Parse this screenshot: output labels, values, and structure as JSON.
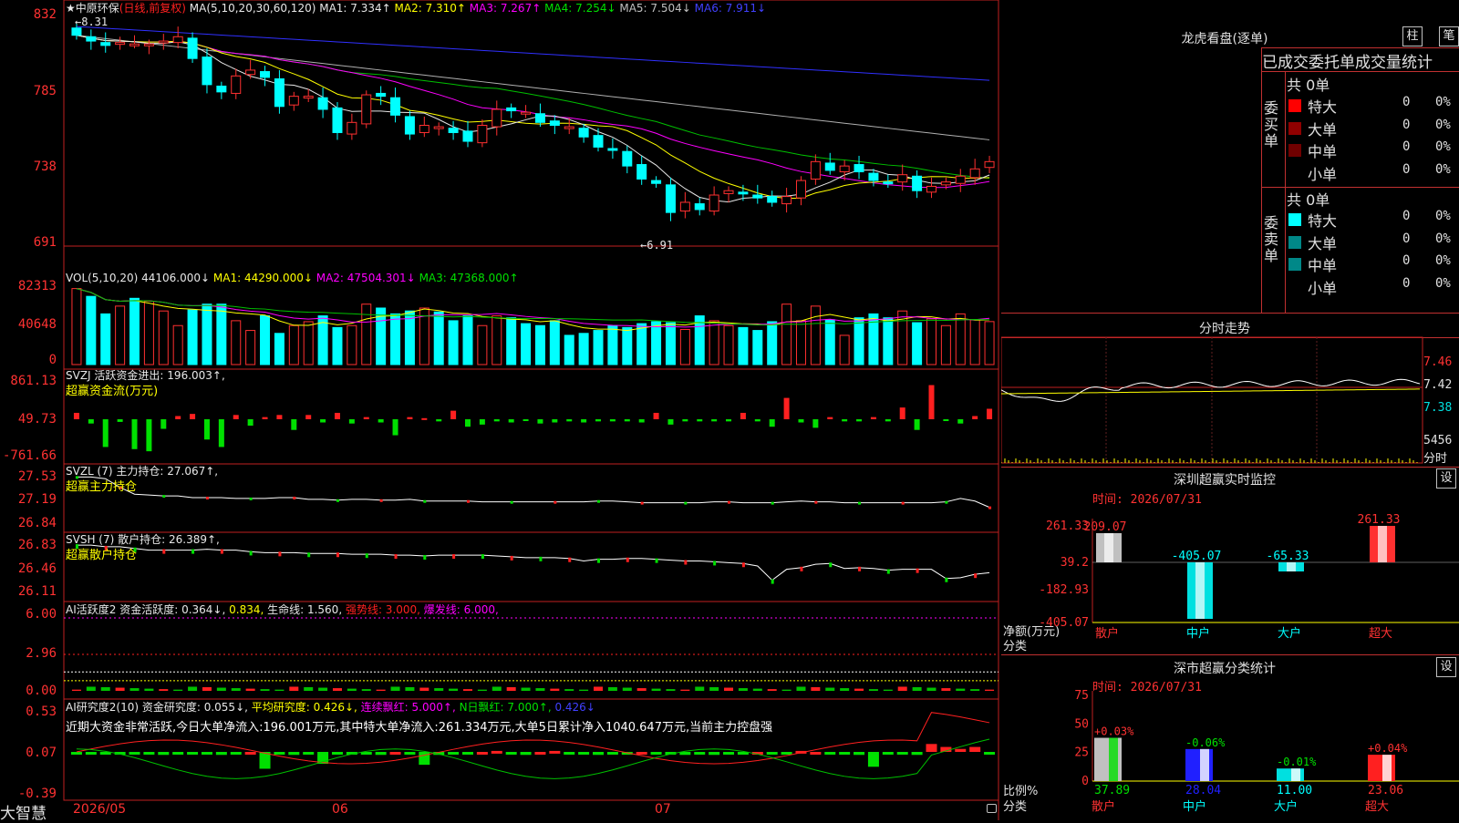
{
  "stock": {
    "name_line": "★中原环保",
    "period": "(日线,前复权)"
  },
  "ma_header": {
    "title": "MA(5,10,20,30,60,120)",
    "items": [
      {
        "label": "MA1:",
        "value": "7.334",
        "dir": "↑",
        "color": "#e8e8e8"
      },
      {
        "label": "MA2:",
        "value": "7.310",
        "dir": "↑",
        "color": "#ffff00"
      },
      {
        "label": "MA3:",
        "value": "7.267",
        "dir": "↑",
        "color": "#ff00ff"
      },
      {
        "label": "MA4:",
        "value": "7.254",
        "dir": "↓",
        "color": "#00e000"
      },
      {
        "label": "MA5:",
        "value": "7.504",
        "dir": "↓",
        "color": "#c0c0c0"
      },
      {
        "label": "MA6:",
        "value": "7.911",
        "dir": "↓",
        "color": "#4040ff"
      }
    ]
  },
  "annotations": {
    "high": "8.31",
    "low": "6.91"
  },
  "price_axis": [
    "832",
    "785",
    "738",
    "691"
  ],
  "vol_header": {
    "title": "VOL(5,10,20)",
    "value": "44106.000↓",
    "items": [
      {
        "label": "MA1:",
        "value": "44290.000↓",
        "color": "#ffff00"
      },
      {
        "label": "MA2:",
        "value": "47504.301↓",
        "color": "#ff00ff"
      },
      {
        "label": "MA3:",
        "value": "47368.000↑",
        "color": "#00e000"
      }
    ]
  },
  "vol_axis": [
    "82313",
    "40648",
    "0"
  ],
  "svzj": {
    "title": "SVZJ",
    "label": "活跃资金进出:",
    "value": "196.003↑,",
    "sub": "超赢资金流(万元)",
    "axis": [
      "861.13",
      "49.73",
      "-761.66"
    ]
  },
  "svzl": {
    "title": "SVZL (7)",
    "label": "主力持仓:",
    "value": "27.067↑,",
    "sub": "超赢主力持仓",
    "axis": [
      "27.53",
      "27.19",
      "26.84"
    ]
  },
  "svsh": {
    "title": "SVSH (7)",
    "label": "散户持仓:",
    "value": "26.389↑,",
    "sub": "超赢散户持仓",
    "axis": [
      "26.83",
      "26.46",
      "26.11"
    ]
  },
  "ai_active": {
    "title": "AI活跃度2",
    "items": [
      {
        "text": "资金活跃度: 0.364↓,",
        "color": "#e8e8e8"
      },
      {
        "text": "0.834,",
        "color": "#ffff00"
      },
      {
        "text": "生命线: 1.560,",
        "color": "#e8e8e8"
      },
      {
        "text": "强势线: 3.000,",
        "color": "#ff2020"
      },
      {
        "text": "爆发线: 6.000,",
        "color": "#ff00ff"
      }
    ],
    "axis": [
      "6.00",
      "2.96",
      "0.00"
    ]
  },
  "ai_research": {
    "title": "AI研究度2(10)",
    "items": [
      {
        "text": "资金研究度: 0.055↓,",
        "color": "#e8e8e8"
      },
      {
        "text": "平均研究度: 0.426↓,",
        "color": "#ffff00"
      },
      {
        "text": "连续飘红: 5.000↑,",
        "color": "#ff00ff"
      },
      {
        "text": "N日飘红: 7.000↑,",
        "color": "#00e000"
      },
      {
        "text": "0.426↓",
        "color": "#4040ff"
      }
    ],
    "comment": "近期大资金非常活跃,今日大单净流入:196.001万元,其中特大单净流入:261.334万元,大单5日累计净入1040.647万元,当前主力控盘强",
    "axis": [
      "0.53",
      "0.07",
      "-0.39"
    ]
  },
  "x_axis": {
    "brand": "大智慧",
    "labels": [
      "2026/05",
      "06",
      "07"
    ]
  },
  "right": {
    "lh_title": "龙虎看盘(逐单)",
    "btn_bar": "柱",
    "btn_pen": "笔",
    "stats_title": "已成交委托单成交量统计",
    "buy": {
      "side": "委买单",
      "total": "共 0单",
      "rows": [
        {
          "label": "特大",
          "count": "0",
          "pct": "0%",
          "color": "#ff0000"
        },
        {
          "label": "大单",
          "count": "0",
          "pct": "0%",
          "color": "#900000"
        },
        {
          "label": "中单",
          "count": "0",
          "pct": "0%",
          "color": "#700000"
        },
        {
          "label": "小单",
          "count": "0",
          "pct": "0%",
          "color": "#000000"
        }
      ]
    },
    "sell": {
      "side": "委卖单",
      "total": "共 0单",
      "rows": [
        {
          "label": "特大",
          "count": "0",
          "pct": "0%",
          "color": "#00ffff"
        },
        {
          "label": "大单",
          "count": "0",
          "pct": "0%",
          "color": "#008888"
        },
        {
          "label": "中单",
          "count": "0",
          "pct": "0%",
          "color": "#008888"
        },
        {
          "label": "小单",
          "count": "0",
          "pct": "0%",
          "color": "#000000"
        }
      ]
    },
    "intraday": {
      "title": "分时走势",
      "axis": [
        "7.46",
        "7.42",
        "7.38"
      ],
      "vol": "5456",
      "vol_unit": "分时"
    },
    "monitor": {
      "title": "深圳超赢实时监控",
      "set": "设",
      "time": "时间: 2026/07/31",
      "axis": [
        "261.33",
        "39.2",
        "-182.93",
        "-405.07"
      ],
      "ylabel": "净额(万元)",
      "xlabel": "分类",
      "cats": [
        "散户",
        "中户",
        "大户",
        "超大"
      ],
      "values": [
        "209.07",
        "-405.07",
        "-65.33",
        "261.33"
      ]
    },
    "classify": {
      "title": "深市超赢分类统计",
      "set": "设",
      "time": "时间: 2026/07/31",
      "axis": [
        "75",
        "50",
        "25",
        "0"
      ],
      "ylabel": "比例%",
      "xlabel": "分类",
      "cats": [
        "散户",
        "中户",
        "大户",
        "超大"
      ],
      "changes": [
        "+0.03%",
        "-0.06%",
        "-0.01%",
        "+0.04%"
      ],
      "values": [
        "37.89",
        "28.04",
        "11.00",
        "23.06"
      ]
    }
  },
  "chart_data": [
    {
      "type": "candlestick",
      "title": "中原环保 (日线,前复权)",
      "ylim": [
        6.8,
        8.4
      ],
      "x": [
        "2026/05",
        "06",
        "07"
      ],
      "ma": {
        "MA1": 7.334,
        "MA2": 7.31,
        "MA3": 7.267,
        "MA4": 7.254,
        "MA5": 7.504,
        "MA6": 7.911
      },
      "high": 8.31,
      "low": 6.91,
      "close": [
        8.22,
        8.18,
        8.15,
        8.17,
        8.16,
        8.16,
        8.18,
        8.21,
        8.06,
        7.88,
        7.83,
        7.94,
        7.98,
        7.93,
        7.73,
        7.8,
        7.8,
        7.71,
        7.55,
        7.62,
        7.81,
        7.8,
        7.67,
        7.54,
        7.6,
        7.59,
        7.55,
        7.49,
        7.6,
        7.71,
        7.7,
        7.69,
        7.62,
        7.6,
        7.59,
        7.52,
        7.45,
        7.43,
        7.32,
        7.23,
        7.2,
        7.0,
        7.07,
        7.02,
        7.12,
        7.15,
        7.13,
        7.1,
        7.07,
        7.11,
        7.22,
        7.35,
        7.29,
        7.32,
        7.28,
        7.22,
        7.2,
        7.26,
        7.15,
        7.18,
        7.21,
        7.25,
        7.3,
        7.35
      ]
    },
    {
      "type": "bar",
      "title": "VOL(5,10,20)",
      "ylim": [
        0,
        82313
      ],
      "values": [
        78000,
        70000,
        52000,
        60000,
        68000,
        65000,
        55000,
        40000,
        56000,
        62000,
        62000,
        45000,
        35000,
        50000,
        32000,
        40000,
        44000,
        50000,
        38000,
        40000,
        62000,
        58000,
        52000,
        55000,
        58000,
        54000,
        45000,
        50000,
        40000,
        50000,
        48000,
        42000,
        40000,
        45000,
        30000,
        32000,
        35000,
        40000,
        38000,
        42000,
        44000,
        43000,
        36000,
        50000,
        45000,
        40000,
        38000,
        35000,
        44000,
        62000,
        45000,
        60000,
        46000,
        30000,
        48000,
        52000,
        48000,
        55000,
        43000,
        47000,
        40000,
        52000,
        46000,
        44106
      ]
    },
    {
      "type": "bar",
      "title": "SVZJ 活跃资金进出",
      "ylim": [
        -761.66,
        861.13
      ],
      "values": [
        120,
        -80,
        -520,
        -50,
        -560,
        -600,
        -180,
        60,
        100,
        -380,
        -520,
        80,
        -120,
        40,
        80,
        -200,
        80,
        -60,
        120,
        -80,
        40,
        -60,
        -300,
        40,
        20,
        -40,
        160,
        -140,
        -100,
        -40,
        -60,
        -20,
        -80,
        -60,
        -40,
        -60,
        -40,
        -40,
        -40,
        -60,
        120,
        -100,
        -40,
        -40,
        -40,
        -40,
        120,
        -40,
        -140,
        400,
        -60,
        -160,
        40,
        -40,
        -40,
        40,
        -40,
        220,
        -200,
        640,
        -20,
        -80,
        60,
        196
      ]
    },
    {
      "type": "line",
      "title": "SVZL 主力持仓",
      "ylim": [
        26.84,
        27.53
      ],
      "values": [
        27.42,
        27.42,
        27.4,
        27.3,
        27.22,
        27.21,
        27.2,
        27.2,
        27.18,
        27.18,
        27.18,
        27.17,
        27.17,
        27.17,
        27.18,
        27.18,
        27.16,
        27.16,
        27.15,
        27.16,
        27.16,
        27.15,
        27.15,
        27.16,
        27.14,
        27.14,
        27.14,
        27.14,
        27.13,
        27.13,
        27.13,
        27.13,
        27.13,
        27.13,
        27.13,
        27.13,
        27.14,
        27.14,
        27.13,
        27.12,
        27.12,
        27.12,
        27.12,
        27.12,
        27.13,
        27.13,
        27.12,
        27.12,
        27.12,
        27.13,
        27.14,
        27.13,
        27.13,
        27.12,
        27.12,
        27.12,
        27.12,
        27.12,
        27.12,
        27.12,
        27.13,
        27.17,
        27.14,
        27.067
      ]
    },
    {
      "type": "line",
      "title": "SVSH 散户持仓",
      "ylim": [
        26.11,
        26.83
      ],
      "values": [
        26.72,
        26.72,
        26.7,
        26.7,
        26.68,
        26.66,
        26.66,
        26.66,
        26.66,
        26.67,
        26.66,
        26.66,
        26.64,
        26.63,
        26.63,
        26.63,
        26.62,
        26.62,
        26.62,
        26.61,
        26.61,
        26.61,
        26.6,
        26.6,
        26.59,
        26.6,
        26.6,
        26.6,
        26.6,
        26.59,
        26.58,
        26.57,
        26.57,
        26.57,
        26.56,
        26.53,
        26.55,
        26.55,
        26.56,
        26.56,
        26.55,
        26.54,
        26.53,
        26.53,
        26.52,
        26.51,
        26.5,
        26.47,
        26.3,
        26.43,
        26.45,
        26.49,
        26.5,
        26.44,
        26.45,
        26.44,
        26.42,
        26.43,
        26.43,
        26.43,
        26.32,
        26.33,
        26.37,
        26.389
      ]
    },
    {
      "type": "line",
      "title": "AI活跃度2",
      "ylim": [
        0,
        6.0
      ],
      "lines": {
        "强势线": 3.0,
        "爆发线": 6.0,
        "生命线": 1.56
      },
      "series": [
        {
          "values": [
            0.364,
            0.834
          ]
        }
      ]
    },
    {
      "type": "bar",
      "title": "AI研究度2(10)",
      "ylim": [
        -0.39,
        0.53
      ],
      "values": [
        0.05,
        0.05,
        0.06,
        0.05,
        0.06,
        0.05,
        0.04,
        0.05,
        0.06,
        0.05,
        0.04,
        0.05,
        0.07,
        -0.1,
        0.05,
        0.04,
        0.06,
        -0.05,
        0.05,
        0.06,
        0.05,
        0.04,
        0.07,
        0.05,
        -0.06,
        0.04,
        0.05,
        0.06,
        0.07,
        0.08,
        0.06,
        0.04,
        0.07,
        0.08,
        0.06,
        0.05,
        0.04,
        0.05,
        0.06,
        0.07,
        0.06,
        0.05,
        0.04,
        0.05,
        0.04,
        0.05,
        0.06,
        0.07,
        0.05,
        0.06,
        0.08,
        0.07,
        0.05,
        0.06,
        0.04,
        -0.08,
        0.05,
        0.06,
        0.04,
        0.15,
        0.12,
        0.1,
        0.12,
        0.055
      ]
    }
  ]
}
